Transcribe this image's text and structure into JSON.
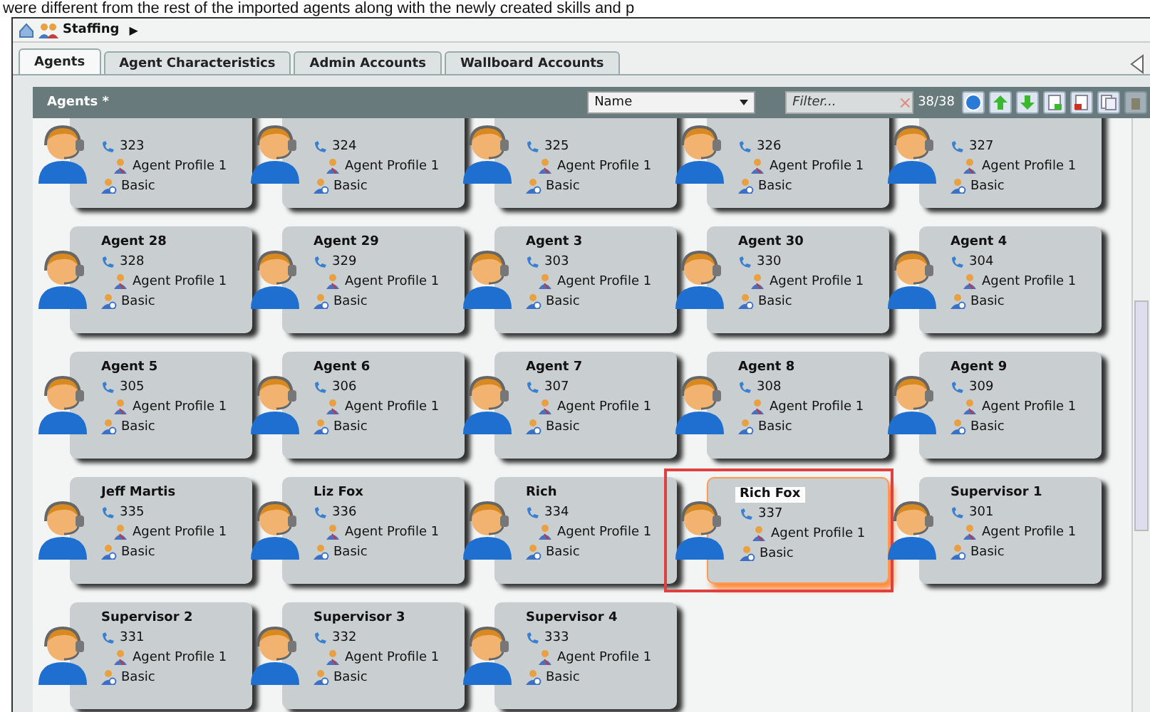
{
  "caption": "were different from the rest of the imported agents along with the newly created skills and p",
  "breadcrumb": {
    "label": "Staffing",
    "arrow": "▶"
  },
  "tabs": [
    {
      "label": "Agents",
      "selected": true
    },
    {
      "label": "Agent Characteristics",
      "selected": false
    },
    {
      "label": "Admin Accounts",
      "selected": false
    },
    {
      "label": "Wallboard Accounts",
      "selected": false
    }
  ],
  "toolbar": {
    "title": "Agents *",
    "sort": "Name",
    "filter": {
      "placeholder": "Filter..."
    },
    "clear": "×",
    "count": "38/38"
  },
  "agents": [
    {
      "ext": "323",
      "profile": "Agent Profile 1",
      "skill": "Basic",
      "selected": false
    },
    {
      "ext": "324",
      "profile": "Agent Profile 1",
      "skill": "Basic",
      "selected": false
    },
    {
      "ext": "325",
      "profile": "Agent Profile 1",
      "skill": "Basic",
      "selected": false
    },
    {
      "ext": "326",
      "profile": "Agent Profile 1",
      "skill": "Basic",
      "selected": false
    },
    {
      "ext": "327",
      "profile": "Agent Profile 1",
      "skill": "Basic",
      "selected": false
    },
    {
      "name": "Agent 28",
      "ext": "328",
      "profile": "Agent Profile 1",
      "skill": "Basic",
      "selected": false
    },
    {
      "name": "Agent 29",
      "ext": "329",
      "profile": "Agent Profile 1",
      "skill": "Basic",
      "selected": false
    },
    {
      "name": "Agent 3",
      "ext": "303",
      "profile": "Agent Profile 1",
      "skill": "Basic",
      "selected": false
    },
    {
      "name": "Agent 30",
      "ext": "330",
      "profile": "Agent Profile 1",
      "skill": "Basic",
      "selected": false
    },
    {
      "name": "Agent 4",
      "ext": "304",
      "profile": "Agent Profile 1",
      "skill": "Basic",
      "selected": false
    },
    {
      "name": "Agent 5",
      "ext": "305",
      "profile": "Agent Profile 1",
      "skill": "Basic",
      "selected": false
    },
    {
      "name": "Agent 6",
      "ext": "306",
      "profile": "Agent Profile 1",
      "skill": "Basic",
      "selected": false
    },
    {
      "name": "Agent 7",
      "ext": "307",
      "profile": "Agent Profile 1",
      "skill": "Basic",
      "selected": false
    },
    {
      "name": "Agent 8",
      "ext": "308",
      "profile": "Agent Profile 1",
      "skill": "Basic",
      "selected": false
    },
    {
      "name": "Agent 9",
      "ext": "309",
      "profile": "Agent Profile 1",
      "skill": "Basic",
      "selected": false
    },
    {
      "name": "Jeff Martis",
      "ext": "335",
      "profile": "Agent Profile 1",
      "skill": "Basic",
      "selected": false
    },
    {
      "name": "Liz Fox",
      "ext": "336",
      "profile": "Agent Profile 1",
      "skill": "Basic",
      "selected": false
    },
    {
      "name": "Rich",
      "ext": "334",
      "profile": "Agent Profile 1",
      "skill": "Basic",
      "selected": false
    },
    {
      "name": "Rich Fox",
      "ext": "337",
      "profile": "Agent Profile 1",
      "skill": "Basic",
      "selected": true
    },
    {
      "name": "Supervisor 1",
      "ext": "301",
      "profile": "Agent Profile 1",
      "skill": "Basic",
      "selected": false
    },
    {
      "name": "Supervisor 2",
      "ext": "331",
      "profile": "Agent Profile 1",
      "skill": "Basic",
      "selected": false
    },
    {
      "name": "Supervisor 3",
      "ext": "332",
      "profile": "Agent Profile 1",
      "skill": "Basic",
      "selected": false
    },
    {
      "name": "Supervisor 4",
      "ext": "333",
      "profile": "Agent Profile 1",
      "skill": "Basic",
      "selected": false
    }
  ]
}
